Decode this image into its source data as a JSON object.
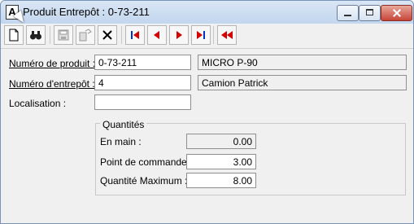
{
  "window": {
    "title": "Produit Entrepôt : 0-73-211",
    "app_icon_letter": "A"
  },
  "toolbar": {
    "buttons": [
      "new-icon",
      "search-binoculars-icon",
      "save-icon",
      "copy-icon",
      "delete-icon",
      "first-record-icon",
      "previous-record-icon",
      "next-record-icon",
      "last-record-icon",
      "rewind-icon"
    ]
  },
  "form": {
    "product": {
      "label": "Numéro de produit :",
      "value": "0-73-211",
      "description": "MICRO P-90"
    },
    "warehouse": {
      "label": "Numéro d'entrepôt :",
      "value": "4",
      "description": "Camion Patrick"
    },
    "location": {
      "label": "Localisation :",
      "value": ""
    },
    "quantities": {
      "title": "Quantités",
      "on_hand_label": "En main :",
      "on_hand_value": "0.00",
      "reorder_point_label": "Point de commande :",
      "reorder_point_value": "3.00",
      "max_quantity_label": "Quantité Maximum :",
      "max_quantity_value": "8.00"
    }
  },
  "colors": {
    "navigation_red": "#d40000",
    "navigation_blue": "#0033cc",
    "window_border": "#7a94b8"
  }
}
